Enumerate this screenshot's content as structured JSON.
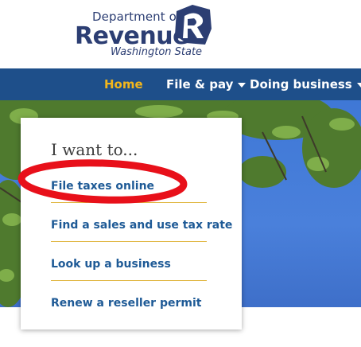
{
  "logo": {
    "line1": "Department of",
    "line2": "Revenue",
    "line3": "Washington State"
  },
  "nav": {
    "items": [
      {
        "label": "Home",
        "active": true
      },
      {
        "label": "File & pay",
        "dropdown": true
      },
      {
        "label": "Doing business",
        "dropdown": true
      }
    ]
  },
  "card": {
    "title": "I want to...",
    "links": [
      "File taxes online",
      "Find a sales and use tax rate",
      "Look up a business",
      "Renew a reseller permit"
    ]
  },
  "colors": {
    "nav_bg": "#1e4f8a",
    "nav_active": "#f2b61c",
    "link": "#1e5a96",
    "divider": "#e0b640",
    "annotation": "#e8101a"
  }
}
